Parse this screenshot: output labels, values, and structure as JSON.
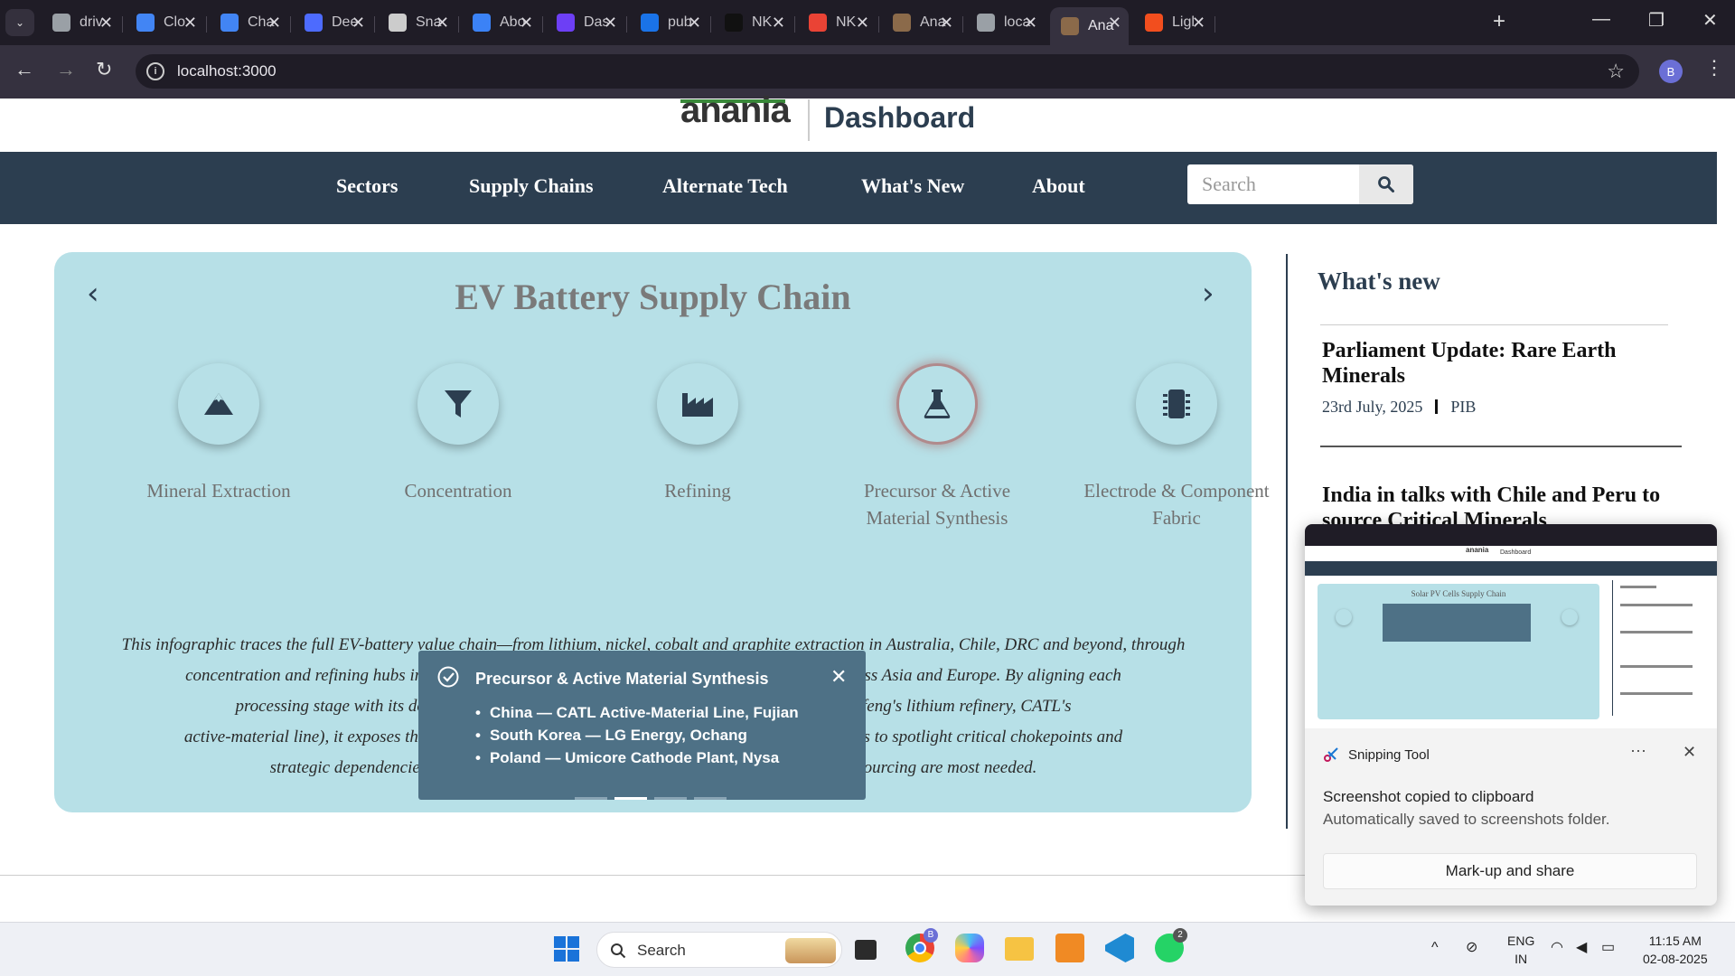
{
  "browser": {
    "tabs": [
      {
        "label": "driv",
        "color": "#9aa0a6"
      },
      {
        "label": "Clo",
        "color": "#4285f4"
      },
      {
        "label": "Cha",
        "color": "#4285f4"
      },
      {
        "label": "Dee",
        "color": "#4d6bfe"
      },
      {
        "label": "Sna",
        "color": "#cccccc"
      },
      {
        "label": "Abo",
        "color": "#3b82f6"
      },
      {
        "label": "Das",
        "color": "#6d3ff5"
      },
      {
        "label": "pub",
        "color": "#1a73e8"
      },
      {
        "label": "NK",
        "color": "#111111"
      },
      {
        "label": "NK",
        "color": "#ea4335"
      },
      {
        "label": "Ana",
        "color": "#8b6a4a"
      },
      {
        "label": "loca",
        "color": "#9aa0a6"
      },
      {
        "label": "Ana",
        "color": "#8b6a4a",
        "active": true
      },
      {
        "label": "Ligl",
        "color": "#f24e1e"
      }
    ],
    "url": "localhost:3000",
    "profile_initial": "B"
  },
  "site": {
    "logo": "anania",
    "title": "Dashboard",
    "nav": [
      "Sectors",
      "Supply Chains",
      "Alternate Tech",
      "What's New",
      "About"
    ],
    "search_placeholder": "Search"
  },
  "carousel": {
    "title": "EV Battery Supply Chain",
    "steps": [
      {
        "label": "Mineral Extraction",
        "icon": "mountain-icon"
      },
      {
        "label": "Concentration",
        "icon": "filter-icon"
      },
      {
        "label": "Refining",
        "icon": "industry-icon"
      },
      {
        "label": "Precursor & Active Material Synthesis",
        "icon": "flask-icon",
        "active": true
      },
      {
        "label": "Electrode & Component Fabric",
        "icon": "microchip-icon"
      }
    ],
    "description_lines": [
      "This infographic traces the full EV-battery value chain—from lithium, nickel, cobalt and graphite extraction in Australia, Chile, DRC and beyond, through",
      "concentration and refining hubs in China, Sou",
      "rication across Asia and Europe. By aligning each",
      "processing stage with its dominant mi",
      "peration, Ganfeng's lithium refinery, CATL's",
      "active-material line), it exposes the geographic",
      "es. Its goal is to spotlight critical chokepoints and",
      "strategic dependencies in the globa",
      "d resilient sourcing are most needed."
    ],
    "popup": {
      "title": "Precursor & Active Material Synthesis",
      "items": [
        "China — CATL Active-Material Line, Fujian",
        "South Korea — LG Energy, Ochang",
        "Poland — Umicore Cathode Plant, Nysa"
      ]
    },
    "slide_count": 4,
    "active_slide": 2
  },
  "whats_new": {
    "heading": "What's new",
    "items": [
      {
        "title": "Parliament Update: Rare Earth Minerals",
        "date": "23rd July, 2025",
        "source": "PIB"
      },
      {
        "title": "India in talks with Chile and Peru to source Critical Minerals"
      }
    ]
  },
  "snipping_tool": {
    "app_name": "Snipping Tool",
    "thumb_title": "Solar PV Cells Supply Chain",
    "message": "Screenshot copied to clipboard",
    "sub": "Automatically saved to screenshots folder.",
    "button": "Mark-up and share"
  },
  "taskbar": {
    "search_placeholder": "Search",
    "lang_top": "ENG",
    "lang_bottom": "IN",
    "time": "11:15 AM",
    "date": "02-08-2025",
    "chrome_badge": "B",
    "whatsapp_badge": "2"
  }
}
